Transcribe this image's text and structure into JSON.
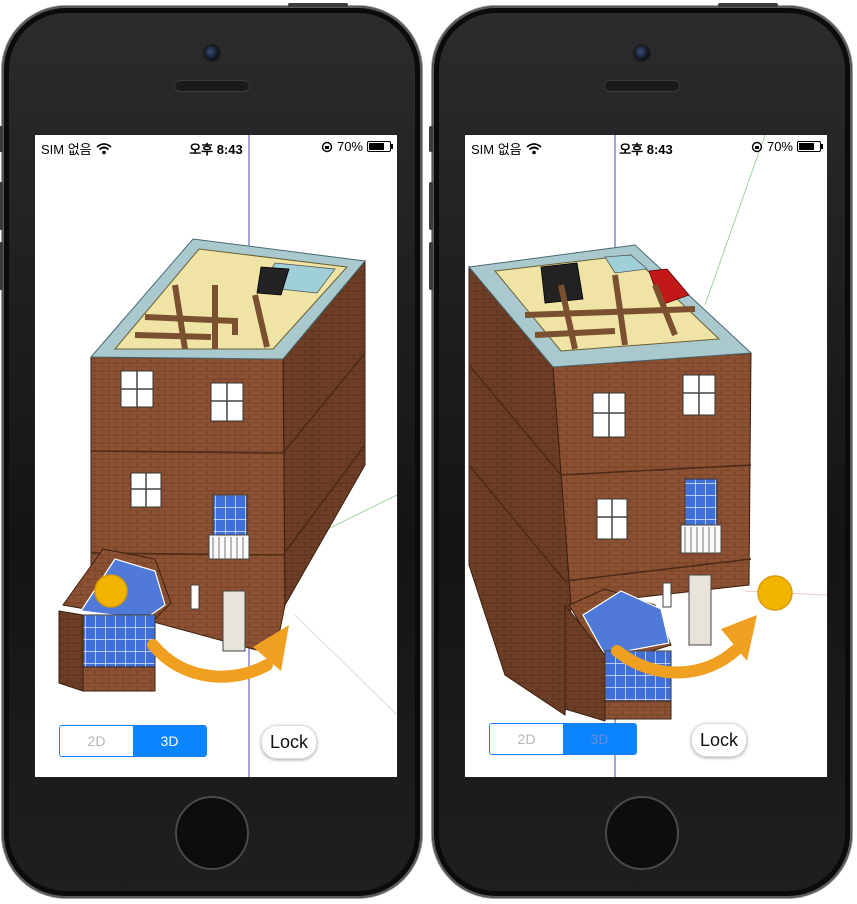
{
  "status_bar": {
    "carrier": "SIM 없음",
    "time": "오후 8:43",
    "battery": "70%",
    "battery_level": 0.7
  },
  "view_toggle": {
    "option_2d": "2D",
    "option_3d": "3D",
    "selected": "3D"
  },
  "lock_button": {
    "label": "Lock"
  },
  "colors": {
    "accent": "#0a84ff",
    "drag_handle": "#f3b400",
    "arrow": "#f0a020",
    "brick": "#8a4f2e",
    "roof_ledge": "#a9c9cf"
  },
  "icons": {
    "wifi": "wifi-icon",
    "orientation_lock": "orientation-lock-icon",
    "battery": "battery-icon",
    "drag_handle": "rotate-handle-icon",
    "rotate_arrow": "rotate-arrow-icon"
  }
}
